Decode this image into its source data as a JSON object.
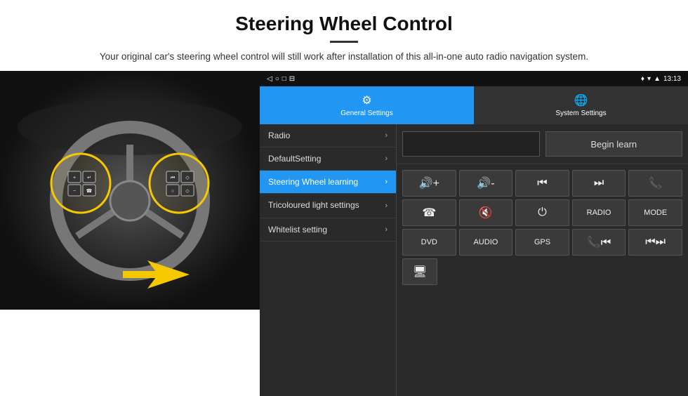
{
  "header": {
    "title": "Steering Wheel Control",
    "subtitle": "Your original car's steering wheel control will still work after installation of this all-in-one auto radio navigation system."
  },
  "status_bar": {
    "time": "13:13",
    "icons": [
      "location",
      "wifi",
      "signal"
    ]
  },
  "nav_bar": {
    "buttons": [
      "◁",
      "○",
      "□",
      "⊟"
    ]
  },
  "tabs": [
    {
      "label": "General Settings",
      "active": true,
      "icon": "⚙"
    },
    {
      "label": "System Settings",
      "active": false,
      "icon": "🌐"
    }
  ],
  "menu": {
    "items": [
      {
        "label": "Radio",
        "active": false
      },
      {
        "label": "DefaultSetting",
        "active": false
      },
      {
        "label": "Steering Wheel learning",
        "active": true
      },
      {
        "label": "Tricoloured light settings",
        "active": false
      },
      {
        "label": "Whitelist setting",
        "active": false
      }
    ]
  },
  "controls": {
    "begin_learn_label": "Begin learn",
    "rows": [
      [
        {
          "label": "🔊+",
          "type": "vol-up"
        },
        {
          "label": "🔊-",
          "type": "vol-down"
        },
        {
          "label": "⏮",
          "type": "prev"
        },
        {
          "label": "⏭",
          "type": "next"
        },
        {
          "label": "📞",
          "type": "call"
        }
      ],
      [
        {
          "label": "☎",
          "type": "answer"
        },
        {
          "label": "🔇",
          "type": "mute"
        },
        {
          "label": "⏻",
          "type": "power"
        },
        {
          "label": "RADIO",
          "type": "radio"
        },
        {
          "label": "MODE",
          "type": "mode"
        }
      ],
      [
        {
          "label": "DVD",
          "type": "dvd"
        },
        {
          "label": "AUDIO",
          "type": "audio"
        },
        {
          "label": "GPS",
          "type": "gps"
        },
        {
          "label": "📞⏮",
          "type": "call-prev"
        },
        {
          "label": "⏮⏭",
          "type": "skip"
        }
      ],
      [
        {
          "label": "🖥",
          "type": "screen"
        }
      ]
    ]
  }
}
